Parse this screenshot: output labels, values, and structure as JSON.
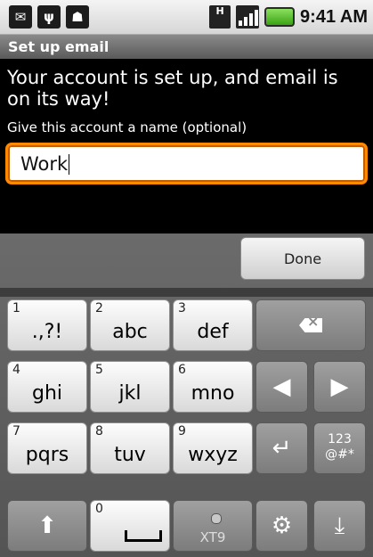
{
  "status_bar": {
    "time": "9:41 AM",
    "icons": [
      "email-icon",
      "usb-icon",
      "android-icon",
      "h-data-icon",
      "signal-icon",
      "battery-icon"
    ],
    "network_label": "H"
  },
  "title_bar": {
    "title": "Set up email"
  },
  "content": {
    "message": "Your account is set up, and email is on its way!",
    "prompt": "Give this account a name (optional)",
    "account_name_value": "Work"
  },
  "keyboard": {
    "done_label": "Done",
    "row1": [
      {
        "num": "1",
        "label": ".,?!"
      },
      {
        "num": "2",
        "label": "abc"
      },
      {
        "num": "3",
        "label": "def"
      }
    ],
    "row2": [
      {
        "num": "4",
        "label": "ghi"
      },
      {
        "num": "5",
        "label": "jkl"
      },
      {
        "num": "6",
        "label": "mno"
      }
    ],
    "row3": [
      {
        "num": "7",
        "label": "pqrs"
      },
      {
        "num": "8",
        "label": "tuv"
      },
      {
        "num": "9",
        "label": "wxyz"
      }
    ],
    "space_num": "0",
    "sym_label_top": "123",
    "sym_label_bottom": "@#*",
    "xt9_label": "XT9"
  },
  "colors": {
    "focus_border": "#ff8a00",
    "accent": "#3aa314"
  }
}
